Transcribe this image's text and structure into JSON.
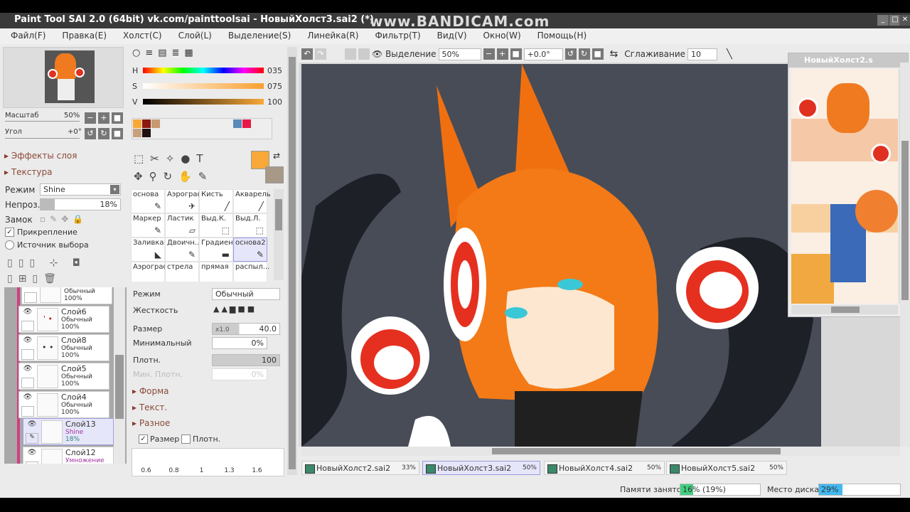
{
  "window": {
    "title": "Paint Tool SAI 2.0 (64bit) vk.com/painttoolsai - НовыйХолст3.sai2 (*)",
    "watermark": "www.BANDICAM.com"
  },
  "menu": [
    "Файл(F)",
    "Правка(E)",
    "Холст(C)",
    "Слой(L)",
    "Выделение(S)",
    "Линейка(R)",
    "Фильтр(T)",
    "Вид(V)",
    "Окно(W)",
    "Помощь(H)"
  ],
  "navigator": {
    "scale_label": "Масштаб",
    "scale": "50%",
    "angle_label": "Угол",
    "angle": "+0°"
  },
  "layer_panel": {
    "effects": "Эффекты слоя",
    "texture": "Текстура",
    "mode_label": "Режим",
    "mode": "Shine",
    "opacity_label": "Непроз.",
    "opacity": "18%",
    "lock_label": "Замок",
    "clip_label": "Прикрепление",
    "source_label": "Источник выбора",
    "layers": [
      {
        "name": "",
        "mode": "Обычный",
        "opacity": "100%"
      },
      {
        "name": "Слой6",
        "mode": "Обычный",
        "opacity": "100%"
      },
      {
        "name": "Слой8",
        "mode": "Обычный",
        "opacity": "100%"
      },
      {
        "name": "Слой5",
        "mode": "Обычный",
        "opacity": "100%"
      },
      {
        "name": "Слой4",
        "mode": "Обычный",
        "opacity": "100%"
      },
      {
        "name": "Слой13",
        "mode": "Shine",
        "opacity": "18%"
      },
      {
        "name": "Слой12",
        "mode": "Умножение",
        "opacity": ""
      }
    ]
  },
  "color": {
    "h_label": "H",
    "h": "035",
    "s_label": "S",
    "s": "075",
    "v_label": "V",
    "v": "100",
    "primary": "#f8a838",
    "secondary": "#a89888"
  },
  "tools": [
    "основа",
    "Аэрограф",
    "Кисть",
    "Акварель",
    "Маркер",
    "Ластик",
    "Выд.К.",
    "Выд.Л.",
    "Заливка",
    "Двоичн...",
    "Градиент",
    "основа2",
    "Аэрограф",
    "стрела",
    "прямая",
    "распыл..."
  ],
  "brush": {
    "mode_label": "Режим",
    "mode": "Обычный",
    "hardness_label": "Жесткость",
    "size_label": "Размер",
    "size_mult": "x1.0",
    "size": "40.0",
    "min_label": "Минимальный",
    "min": "0%",
    "density_label": "Плотн.",
    "density": "100",
    "min_density_label": "Мин. Плотн.",
    "min_density": "0%",
    "shape": "Форма",
    "text": "Текст.",
    "misc": "Разное",
    "chk_size": "Размер",
    "chk_density": "Плотн.",
    "presets": [
      "0.6",
      "0.8",
      "1",
      "1.3",
      "1.6"
    ]
  },
  "toolbar": {
    "selection_label": "Выделение",
    "zoom": "50%",
    "angle": "+0.0°",
    "smoothing_label": "Сглаживание",
    "smoothing": "10"
  },
  "float_window": {
    "title": "НовыйХолст2.s"
  },
  "tabs": [
    {
      "name": "НовыйХолст2.sai2",
      "pct": "33%"
    },
    {
      "name": "НовыйХолст3.sai2",
      "pct": "50%"
    },
    {
      "name": "НовыйХолст4.sai2",
      "pct": "50%"
    },
    {
      "name": "НовыйХолст5.sai2",
      "pct": "50%"
    }
  ],
  "status": {
    "memory_label": "Памяти занято",
    "memory": "16% (19%)",
    "memory_fill": 16,
    "disk_label": "Место диска",
    "disk": "29%",
    "disk_fill": 29
  }
}
